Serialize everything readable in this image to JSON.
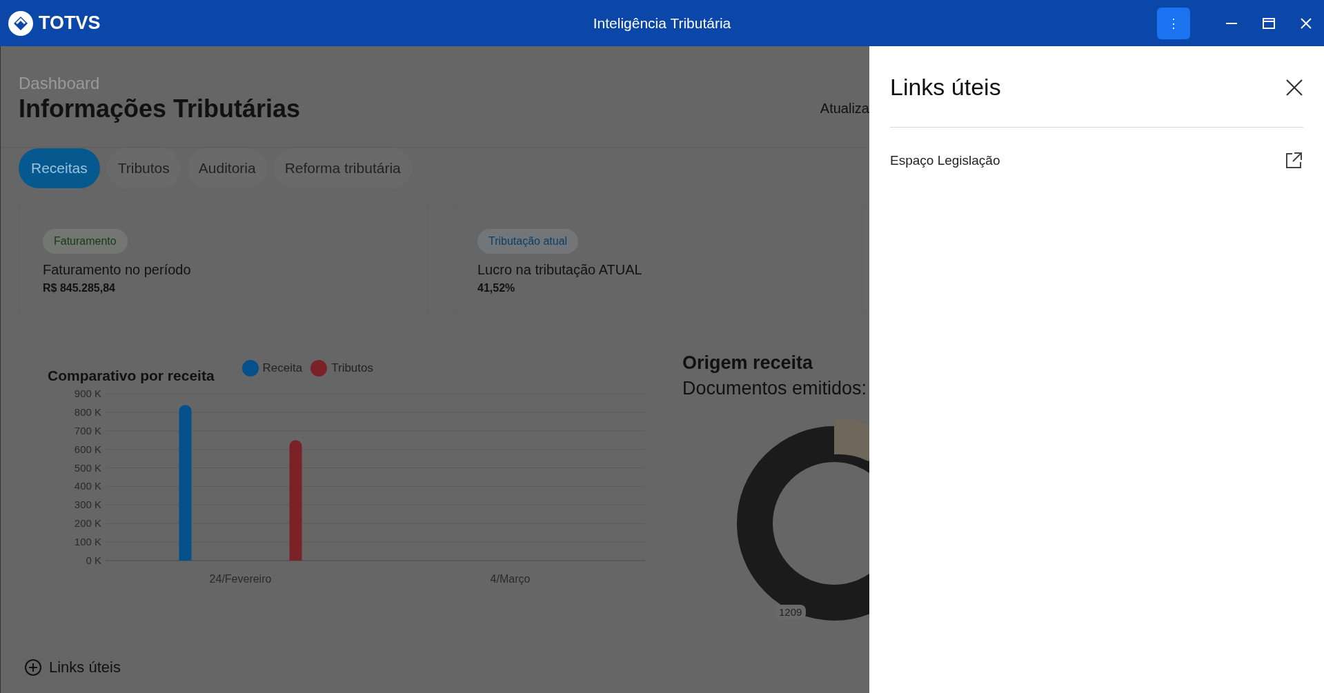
{
  "window": {
    "brand": "TOTVS",
    "title": "Inteligência Tributária",
    "menu_button": "⋮"
  },
  "dashboard": {
    "breadcrumb": "Dashboard",
    "title": "Informações Tributárias",
    "update_text": "Atualiza",
    "tabs": [
      {
        "label": "Receitas",
        "selected": true
      },
      {
        "label": "Tributos",
        "selected": false
      },
      {
        "label": "Auditoria",
        "selected": false
      },
      {
        "label": "Reforma tributária",
        "selected": false
      }
    ],
    "cards": [
      {
        "tag": "Faturamento",
        "color": "#143c14",
        "label": "Faturamento no período",
        "value": "R$ 845.285,84"
      },
      {
        "tag": "Tributação atual",
        "color": "#0a3f6a",
        "label": "Lucro na tributação ATUAL",
        "value": "41,52%"
      }
    ],
    "bar_chart": {
      "title": "Comparativo por receita",
      "chart_data": {
        "type": "bar",
        "categories": [
          "24/Fevereiro",
          "4/Março"
        ],
        "series": [
          {
            "name": "Receita",
            "color": "#04508a",
            "values": [
              840000,
              null
            ]
          },
          {
            "name": "Tributos",
            "color": "#7a2227",
            "values": [
              650000,
              null
            ]
          }
        ],
        "grid": true,
        "ylim": [
          0,
          900000
        ],
        "yticks": [
          {
            "value": 0,
            "label": "0 K"
          },
          {
            "value": 100000,
            "label": "100 K"
          },
          {
            "value": 200000,
            "label": "200 K"
          },
          {
            "value": 300000,
            "label": "300 K"
          },
          {
            "value": 400000,
            "label": "400 K"
          },
          {
            "value": 500000,
            "label": "500 K"
          },
          {
            "value": 600000,
            "label": "600 K"
          },
          {
            "value": 700000,
            "label": "700 K"
          },
          {
            "value": 800000,
            "label": "800 K"
          },
          {
            "value": 900000,
            "label": "900 K"
          }
        ]
      }
    },
    "donut": {
      "title": "Origem receita",
      "subtitle": "Documentos emitidos:",
      "slice_label": "1209"
    },
    "links_button": "Links úteis"
  },
  "drawer": {
    "title": "Links úteis",
    "links": [
      "Espaço Legislação"
    ]
  }
}
